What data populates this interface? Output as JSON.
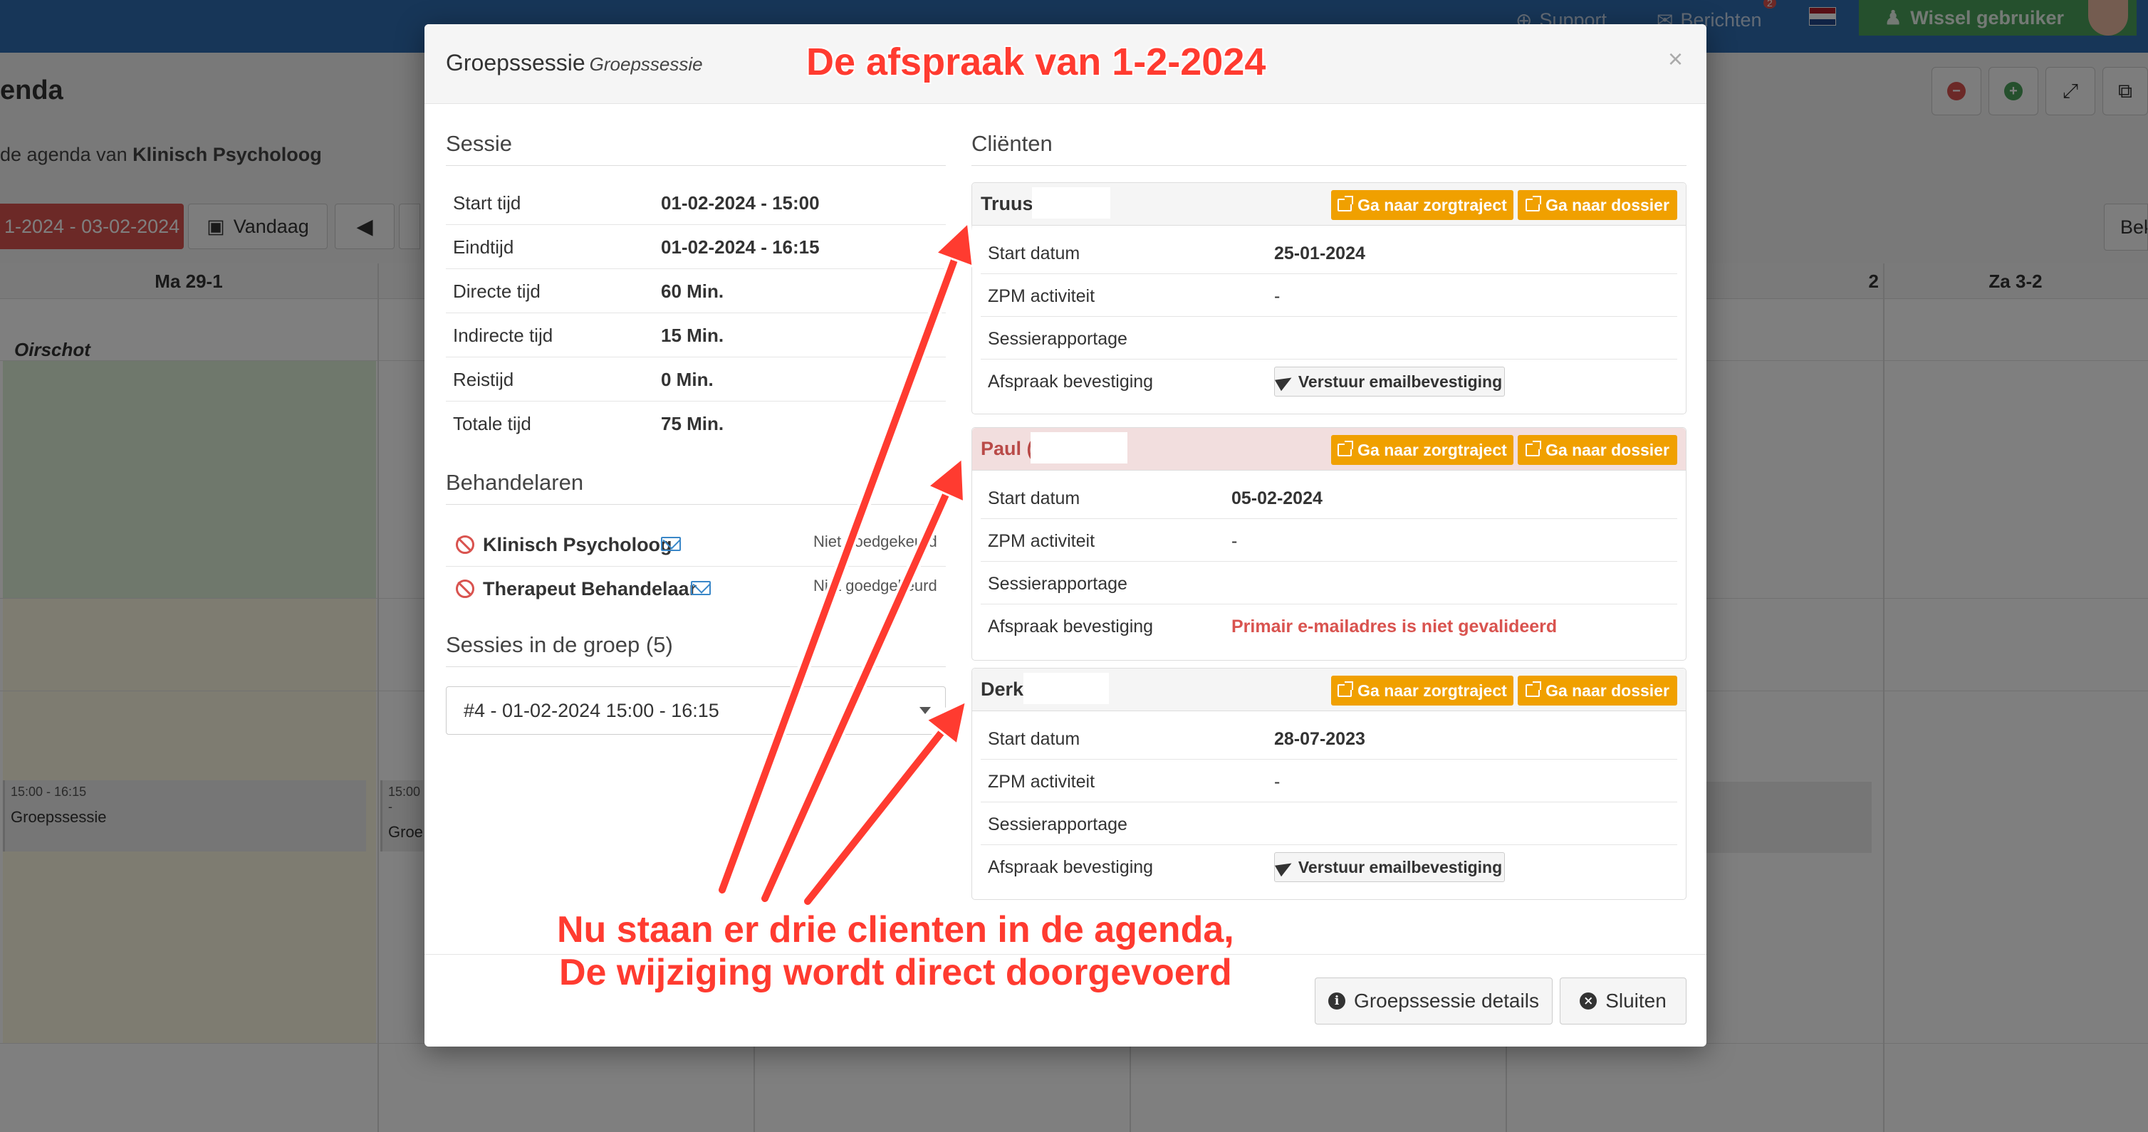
{
  "topbar": {
    "support_label": "Support",
    "berichten_label": "Berichten",
    "berichten_badge": "2",
    "wissel_label": "Wissel gebruiker"
  },
  "page": {
    "title": "enda",
    "subtitle_prefix": "de agenda van ",
    "subtitle_name": "Klinisch Psycholoog",
    "date_range": "1-2024 - 03-02-2024",
    "vandaag_label": "Vandaag",
    "bek_label": "Bek"
  },
  "calendar": {
    "days": [
      "Ma 29-1",
      "",
      "",
      "",
      "2",
      "Za 3-2"
    ],
    "location": "Oirschot",
    "events": [
      {
        "time": "15:00 - 16:15",
        "name": "Groepssessie"
      },
      {
        "time": "15:00 -",
        "name": "Groep"
      }
    ]
  },
  "modal": {
    "title": "Groepssessie",
    "title_sub": "Groepssessie",
    "close": "×",
    "sessie": {
      "heading": "Sessie",
      "rows": [
        {
          "label": "Start tijd",
          "value": "01-02-2024 - 15:00"
        },
        {
          "label": "Eindtijd",
          "value": "01-02-2024 - 16:15"
        },
        {
          "label": "Directe tijd",
          "value": "60 Min."
        },
        {
          "label": "Indirecte tijd",
          "value": "15 Min."
        },
        {
          "label": "Reistijd",
          "value": "0 Min."
        },
        {
          "label": "Totale tijd",
          "value": "75 Min."
        }
      ]
    },
    "behandelaren": {
      "heading": "Behandelaren",
      "rows": [
        {
          "name": "Klinisch Psycholoog",
          "status": "Niet goedgekeurd"
        },
        {
          "name": "Therapeut Behandelaar",
          "status": "Niet goedgekeurd"
        }
      ]
    },
    "groep": {
      "heading": "Sessies in de groep (5)",
      "selected": "#4 - 01-02-2024 15:00 - 16:15"
    },
    "clienten": {
      "heading": "Cliënten",
      "btn_zorgtraject": "Ga naar zorgtraject",
      "btn_dossier": "Ga naar dossier",
      "label_start": "Start datum",
      "label_zpm": "ZPM activiteit",
      "label_rapport": "Sessierapportage",
      "label_bevestiging": "Afspraak bevestiging",
      "mail_btn": "Verstuur emailbevestiging",
      "items": [
        {
          "name": "Truus",
          "start": "25-01-2024",
          "zpm": "-",
          "rapport": "",
          "bevestiging": ""
        },
        {
          "name": "Paul (",
          "start": "05-02-2024",
          "zpm": "-",
          "rapport": "",
          "bevestiging": "Primair e-mailadres is niet gevalideerd"
        },
        {
          "name": "Derk",
          "start": "28-07-2023",
          "zpm": "-",
          "rapport": "",
          "bevestiging": ""
        }
      ]
    },
    "footer": {
      "details_label": "Groepssessie details",
      "close_label": "Sluiten"
    }
  },
  "annotations": {
    "title": "De afspraak van 1-2-2024",
    "body_line1": "Nu staan er drie clienten in de agenda,",
    "body_line2": "De wijziging wordt direct doorgevoerd"
  },
  "colors": {
    "header_blue": "#2f6db0",
    "success_green": "#4aa15b",
    "danger_red": "#d9534f",
    "warning_orange": "#f0a000",
    "annotation_red": "#ff3b30"
  }
}
